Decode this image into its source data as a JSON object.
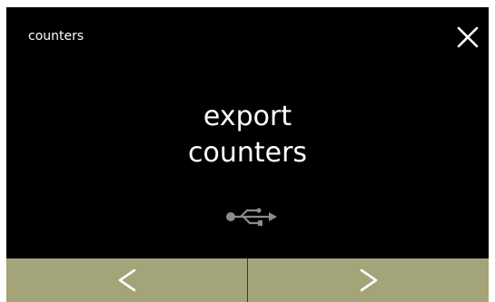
{
  "header": {
    "title": "counters",
    "close_icon": "close-icon"
  },
  "main": {
    "line1": "export",
    "line2": "counters",
    "usb_icon": "usb-icon"
  },
  "nav": {
    "prev_icon": "chevron-left-icon",
    "next_icon": "chevron-right-icon"
  },
  "colors": {
    "screen_background": "#000000",
    "text": "#ffffff",
    "nav_background": "#a3a477",
    "icon_gray": "#8c8c8c"
  }
}
